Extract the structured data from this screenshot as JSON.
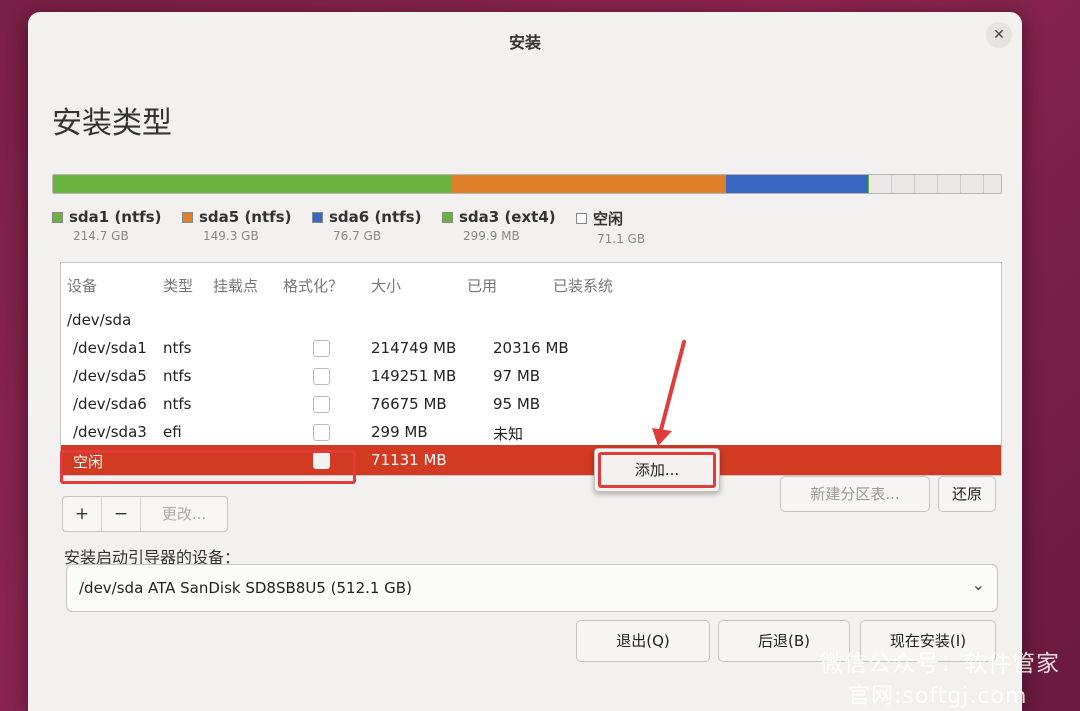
{
  "window": {
    "title": "安装",
    "close_glyph": "✕"
  },
  "page_title": "安装类型",
  "disk_bar": [
    {
      "name": "sda1",
      "color": "#6ab23e",
      "fraction": 0.42
    },
    {
      "name": "sda5",
      "color": "#e07f2a",
      "fraction": 0.29
    },
    {
      "name": "sda6",
      "color": "#3a66c4",
      "fraction": 0.15
    },
    {
      "name": "sda3",
      "color": "#6ab23e",
      "fraction": 0.001
    },
    {
      "name": "free",
      "color": "#e9e8e6",
      "fraction": 0.139
    }
  ],
  "legend": [
    {
      "label": "sda1 (ntfs)",
      "size": "214.7 GB",
      "color": "#6ab23e"
    },
    {
      "label": "sda5 (ntfs)",
      "size": "149.3 GB",
      "color": "#e07f2a"
    },
    {
      "label": "sda6 (ntfs)",
      "size": "76.7 GB",
      "color": "#3a66c4"
    },
    {
      "label": "sda3 (ext4)",
      "size": "299.9 MB",
      "color": "#6ab23e"
    },
    {
      "label": "空闲",
      "size": "71.1 GB",
      "color": "#ffffff"
    }
  ],
  "table": {
    "headers": {
      "device": "设备",
      "type": "类型",
      "mount": "挂载点",
      "format": "格式化？",
      "size": "大小",
      "used": "已用",
      "system": "已装系统"
    },
    "disk": "/dev/sda",
    "rows": [
      {
        "device": "/dev/sda1",
        "type": "ntfs",
        "size": "214749 MB",
        "used": "20316 MB"
      },
      {
        "device": "/dev/sda5",
        "type": "ntfs",
        "size": "149251 MB",
        "used": "97 MB"
      },
      {
        "device": "/dev/sda6",
        "type": "ntfs",
        "size": "76675 MB",
        "used": "95 MB"
      },
      {
        "device": "/dev/sda3",
        "type": "efi",
        "size": "299 MB",
        "used": "未知"
      }
    ],
    "free_row": {
      "device": "空闲",
      "size": "71131 MB"
    }
  },
  "buttons": {
    "add_popup": "添加...",
    "plus": "+",
    "minus": "−",
    "change": "更改...",
    "new_table": "新建分区表...",
    "revert": "还原",
    "quit": "退出(Q)",
    "back": "后退(B)",
    "install_now": "现在安装(I)"
  },
  "bootloader": {
    "label": "安装启动引导器的设备：",
    "value": "/dev/sda   ATA SanDisk SD8SB8U5 (512.1 GB)",
    "chevron": "⌄"
  },
  "watermark": {
    "line1": "微信公众号：软件管家",
    "line2": "官网:softgj.com"
  }
}
